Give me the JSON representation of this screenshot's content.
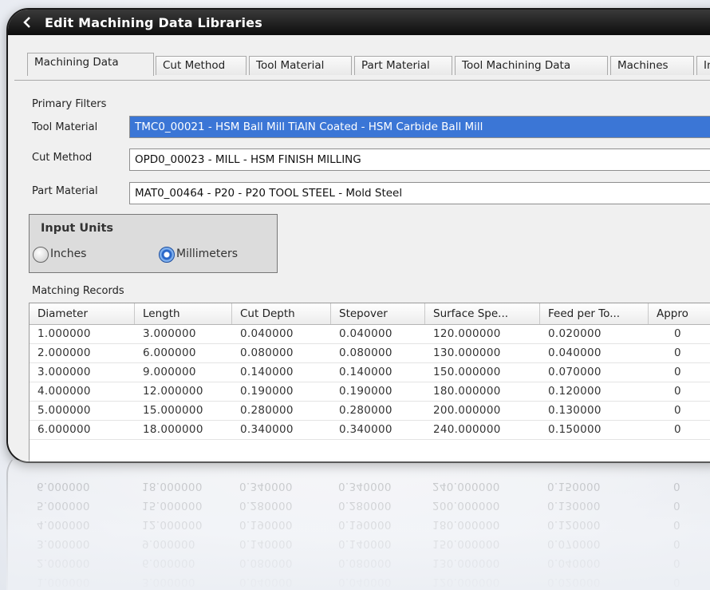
{
  "window": {
    "title": "Edit Machining Data Libraries"
  },
  "tabs": [
    {
      "label": "Machining Data"
    },
    {
      "label": "Cut Method"
    },
    {
      "label": "Tool Material"
    },
    {
      "label": "Part Material"
    },
    {
      "label": "Tool Machining Data"
    },
    {
      "label": "Machines"
    },
    {
      "label": "In"
    }
  ],
  "filters": {
    "heading": "Primary Filters",
    "tool_material_label": "Tool Material",
    "tool_material_value": "TMC0_00021 - HSM Ball Mill TiAlN Coated - HSM Carbide Ball Mill",
    "cut_method_label": "Cut Method",
    "cut_method_value": "OPD0_00023 - MILL - HSM FINISH MILLING",
    "part_material_label": "Part Material",
    "part_material_value": "MAT0_00464 - P20 - P20 TOOL STEEL - Mold Steel"
  },
  "units": {
    "heading": "Input Units",
    "inches": "Inches",
    "millimeters": "Millimeters",
    "selected": "Millimeters"
  },
  "records": {
    "heading": "Matching Records",
    "columns": [
      "Diameter",
      "Length",
      "Cut Depth",
      "Stepover",
      "Surface Spe...",
      "Feed per To...",
      "Appro"
    ],
    "rows": [
      [
        "1.000000",
        "3.000000",
        "0.040000",
        "0.040000",
        "120.000000",
        "0.020000",
        "0"
      ],
      [
        "2.000000",
        "6.000000",
        "0.080000",
        "0.080000",
        "130.000000",
        "0.040000",
        "0"
      ],
      [
        "3.000000",
        "9.000000",
        "0.140000",
        "0.140000",
        "150.000000",
        "0.070000",
        "0"
      ],
      [
        "4.000000",
        "12.000000",
        "0.190000",
        "0.190000",
        "180.000000",
        "0.120000",
        "0"
      ],
      [
        "5.000000",
        "15.000000",
        "0.280000",
        "0.280000",
        "200.000000",
        "0.130000",
        "0"
      ],
      [
        "6.000000",
        "18.000000",
        "0.340000",
        "0.340000",
        "240.000000",
        "0.150000",
        "0"
      ]
    ]
  },
  "colors": {
    "selection": "#3b76d6",
    "titlebar": "#111111"
  }
}
